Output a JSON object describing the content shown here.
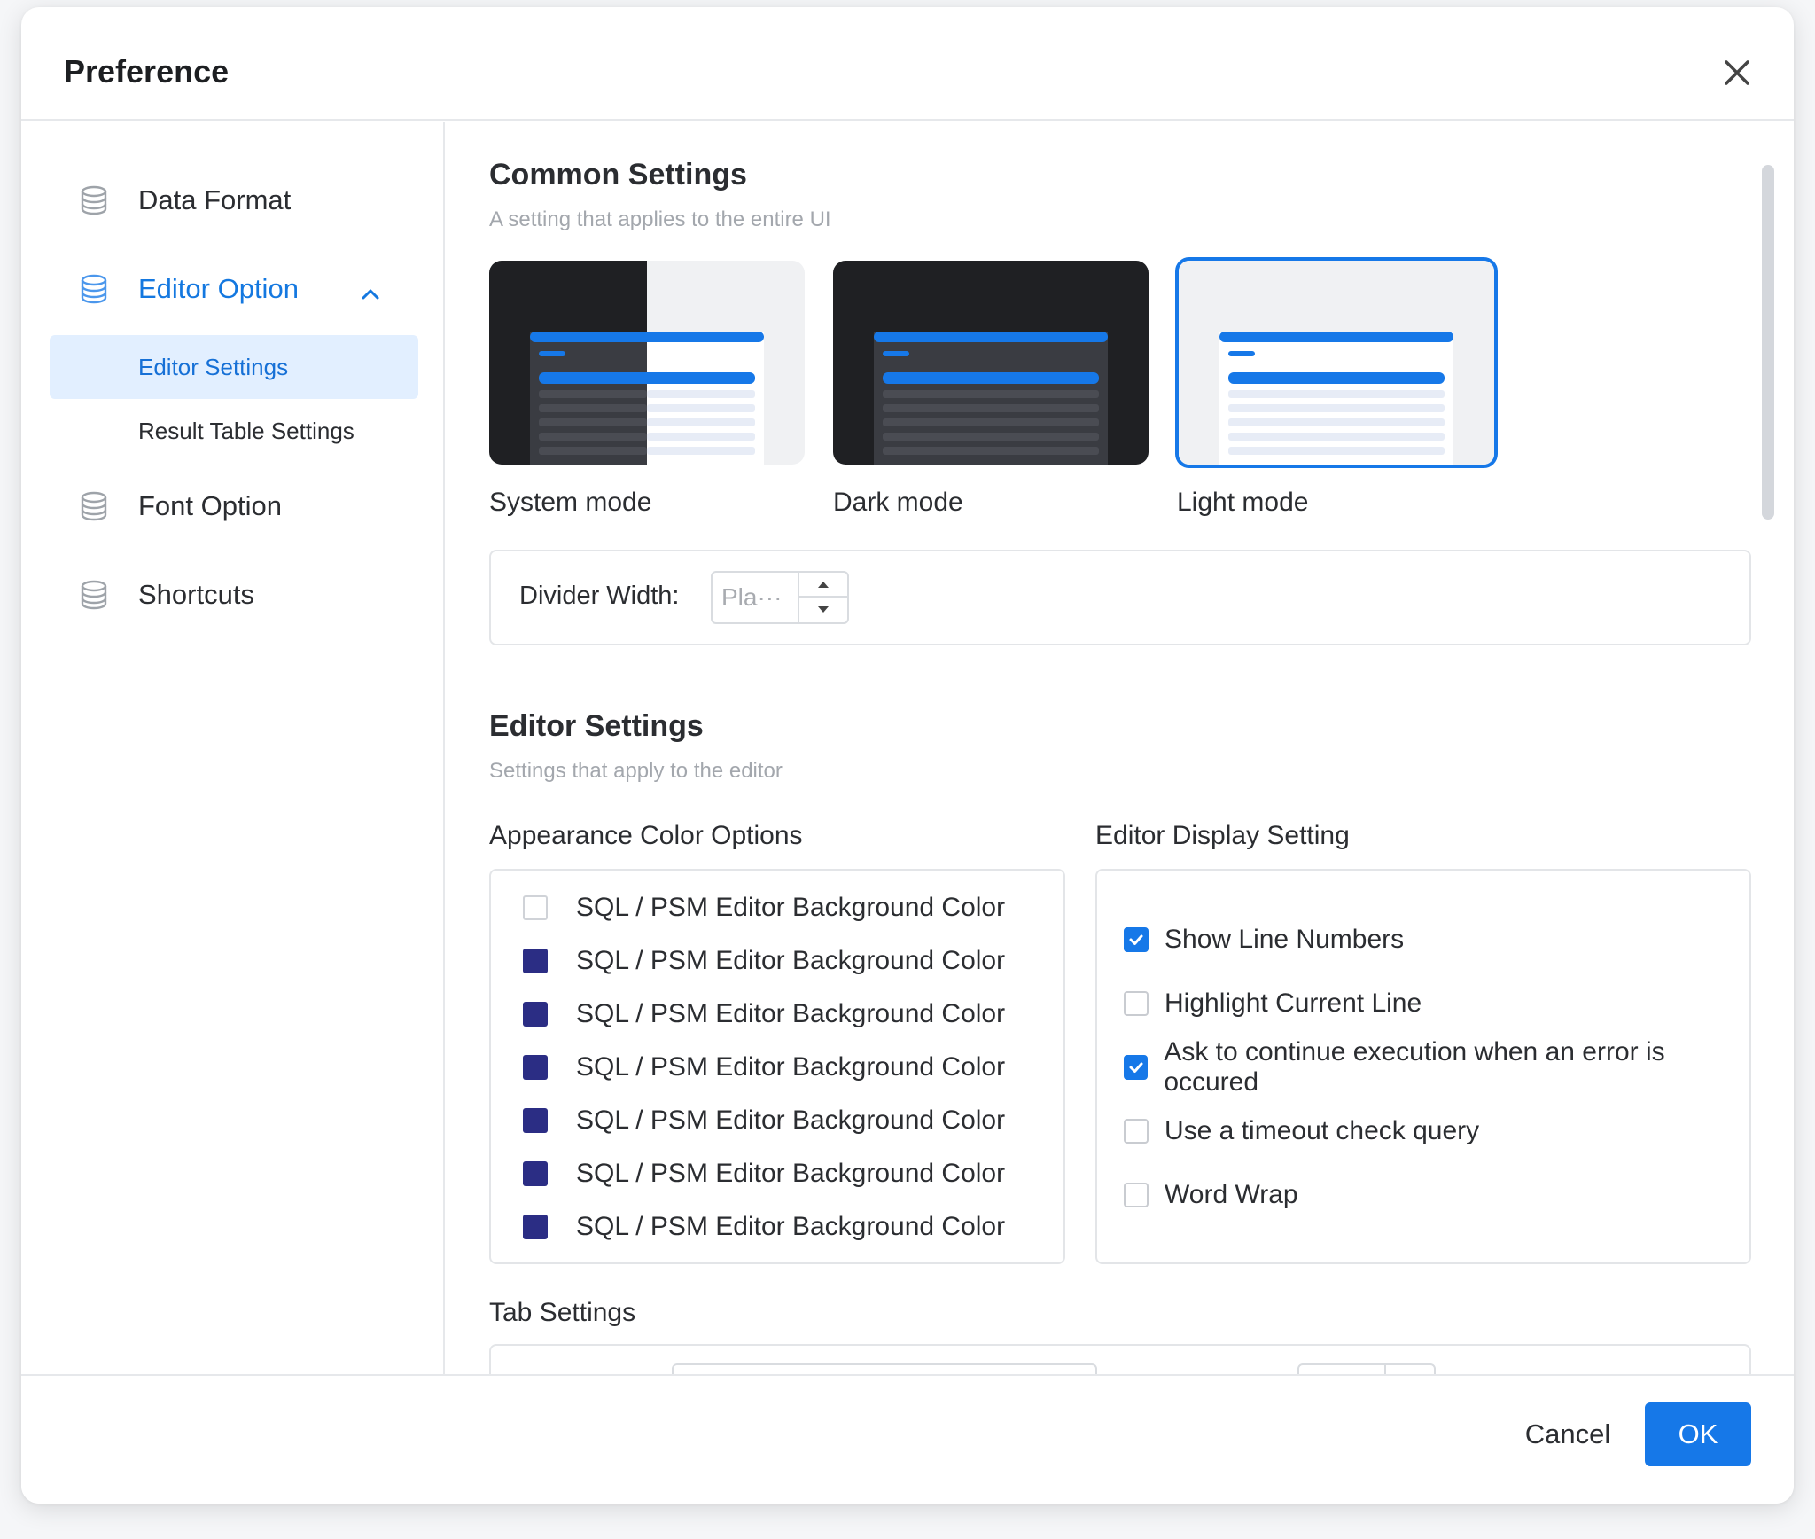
{
  "dialog": {
    "title": "Preference"
  },
  "sidebar": {
    "items": [
      {
        "label": "Data Format",
        "icon": "database-icon"
      },
      {
        "label": "Editor Option",
        "icon": "database-icon",
        "expanded": true,
        "children": [
          {
            "label": "Editor Settings",
            "selected": true
          },
          {
            "label": "Result Table Settings"
          }
        ]
      },
      {
        "label": "Font Option",
        "icon": "database-icon"
      },
      {
        "label": "Shortcuts",
        "icon": "database-icon"
      }
    ]
  },
  "common": {
    "title": "Common Settings",
    "subtitle": "A setting that applies to the entire UI",
    "modes": [
      {
        "label": "System mode"
      },
      {
        "label": "Dark mode"
      },
      {
        "label": "Light mode",
        "selected": true
      }
    ],
    "divider": {
      "label": "Divider Width:",
      "placeholder": "Pla···"
    }
  },
  "editor": {
    "title": "Editor Settings",
    "subtitle": "Settings that apply to the editor",
    "appearance": {
      "title": "Appearance Color Options",
      "items": [
        {
          "label": "SQL / PSM Editor Background Color",
          "color": "#ffffff"
        },
        {
          "label": "SQL / PSM Editor Background Color",
          "color": "#2b2d84"
        },
        {
          "label": "SQL / PSM Editor Background Color",
          "color": "#2b2d84"
        },
        {
          "label": "SQL / PSM Editor Background Color",
          "color": "#2b2d84"
        },
        {
          "label": "SQL / PSM Editor Background Color",
          "color": "#2b2d84"
        },
        {
          "label": "SQL / PSM Editor Background Color",
          "color": "#2b2d84"
        },
        {
          "label": "SQL / PSM Editor Background Color",
          "color": "#2b2d84"
        }
      ]
    },
    "display": {
      "title": "Editor Display Setting",
      "items": [
        {
          "label": "Show Line Numbers",
          "checked": true
        },
        {
          "label": "Highlight Current Line",
          "checked": false
        },
        {
          "label": "Ask to continue execution when an error is occured",
          "checked": true
        },
        {
          "label": "Use a timeout check query",
          "checked": false
        },
        {
          "label": "Word Wrap",
          "checked": false
        }
      ]
    },
    "tab": {
      "title": "Tab Settings"
    }
  },
  "footer": {
    "cancel": "Cancel",
    "ok": "OK"
  },
  "colors": {
    "accent": "#1678e8",
    "selected_bg": "#e2efff",
    "swatch": "#2b2d84"
  }
}
